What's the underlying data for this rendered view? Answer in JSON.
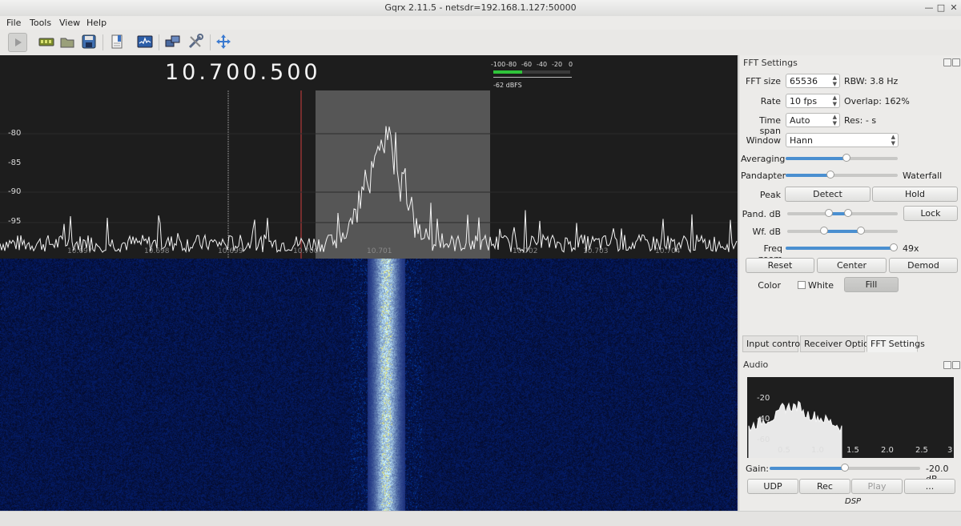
{
  "window": {
    "title": "Gqrx 2.11.5 - netsdr=192.168.1.127:50000"
  },
  "menu": [
    "File",
    "Tools",
    "View",
    "Help"
  ],
  "toolbar": [
    "play-button",
    "hardware-icon",
    "open-icon",
    "save-icon",
    "bookmark-icon",
    "fft-icon",
    "network-icon",
    "tools-icon",
    "fullscreen-icon"
  ],
  "spectrum": {
    "frequency": "10.700.500",
    "y_labels": [
      "-80",
      "-85",
      "-90",
      "-95"
    ],
    "x_labels": [
      "10.697",
      "10.698",
      "10.699",
      "10.700",
      "10.701",
      "10.702",
      "10.703",
      "10.704"
    ],
    "meter": {
      "scale": [
        "-100",
        "-80",
        "-60",
        "-40",
        "-20",
        "0"
      ],
      "level_text": "-62 dBFS",
      "level_fraction": 0.38,
      "fill_color": "#2fc43a"
    }
  },
  "fft_settings": {
    "title": "FFT Settings",
    "fft_size": {
      "label": "FFT size",
      "value": "65536",
      "info": "RBW: 3.8 Hz"
    },
    "rate": {
      "label": "Rate",
      "value": "10 fps",
      "info": "Overlap: 162%"
    },
    "time_span": {
      "label": "Time span",
      "value": "Auto",
      "info": "Res: - s"
    },
    "window": {
      "label": "Window",
      "value": "Hann"
    },
    "averaging": {
      "label": "Averaging",
      "fraction": 0.54
    },
    "pandapter": {
      "label": "Pandapter",
      "fraction": 0.4,
      "right_label": "Waterfall"
    },
    "peak": {
      "label": "Peak",
      "detect": "Detect",
      "hold": "Hold"
    },
    "pand_db": {
      "label": "Pand. dB",
      "range": [
        0.38,
        0.55
      ],
      "lock": "Lock"
    },
    "wf_db": {
      "label": "Wf. dB",
      "range": [
        0.33,
        0.67
      ]
    },
    "freq_zoom": {
      "label": "Freq zoom",
      "fraction": 0.98,
      "value": "49x"
    },
    "reset": "Reset",
    "center": "Center",
    "demod": "Demod",
    "color": {
      "label": "Color",
      "white": "White",
      "fill": "Fill"
    }
  },
  "tabs": [
    "Input controls",
    "Receiver Options",
    "FFT Settings"
  ],
  "active_tab": 2,
  "audio": {
    "title": "Audio",
    "y_labels": [
      "-20",
      "-40",
      "-60"
    ],
    "x_labels": [
      "0.5",
      "1.0",
      "1.5",
      "2.0",
      "2.5",
      "3"
    ],
    "gain_label": "Gain:",
    "gain_value": "-20.0 dB",
    "gain_fraction": 0.5,
    "buttons": {
      "udp": "UDP",
      "rec": "Rec",
      "play": "Play",
      "more": "..."
    },
    "dsp": "DSP"
  }
}
